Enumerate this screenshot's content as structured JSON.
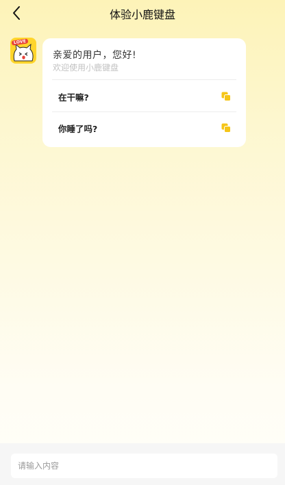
{
  "header": {
    "title": "体验小鹿键盘",
    "back_icon": "chevron-left-icon"
  },
  "avatar": {
    "badge_text": "LOVE",
    "icon": "cat-avatar-icon",
    "bg_color": "#ffd52c"
  },
  "bubble": {
    "greeting": "亲爱的用户，您好!",
    "subtitle": "欢迎使用小鹿键盘",
    "phrases": [
      {
        "text": "在干嘛?",
        "icon": "copy-icon"
      },
      {
        "text": "你睡了吗?",
        "icon": "copy-icon"
      }
    ]
  },
  "input": {
    "placeholder": "请输入内容",
    "value": ""
  },
  "colors": {
    "accent": "#f5c518",
    "background_top": "#fdf3b8",
    "background_bottom": "#fffef9"
  }
}
